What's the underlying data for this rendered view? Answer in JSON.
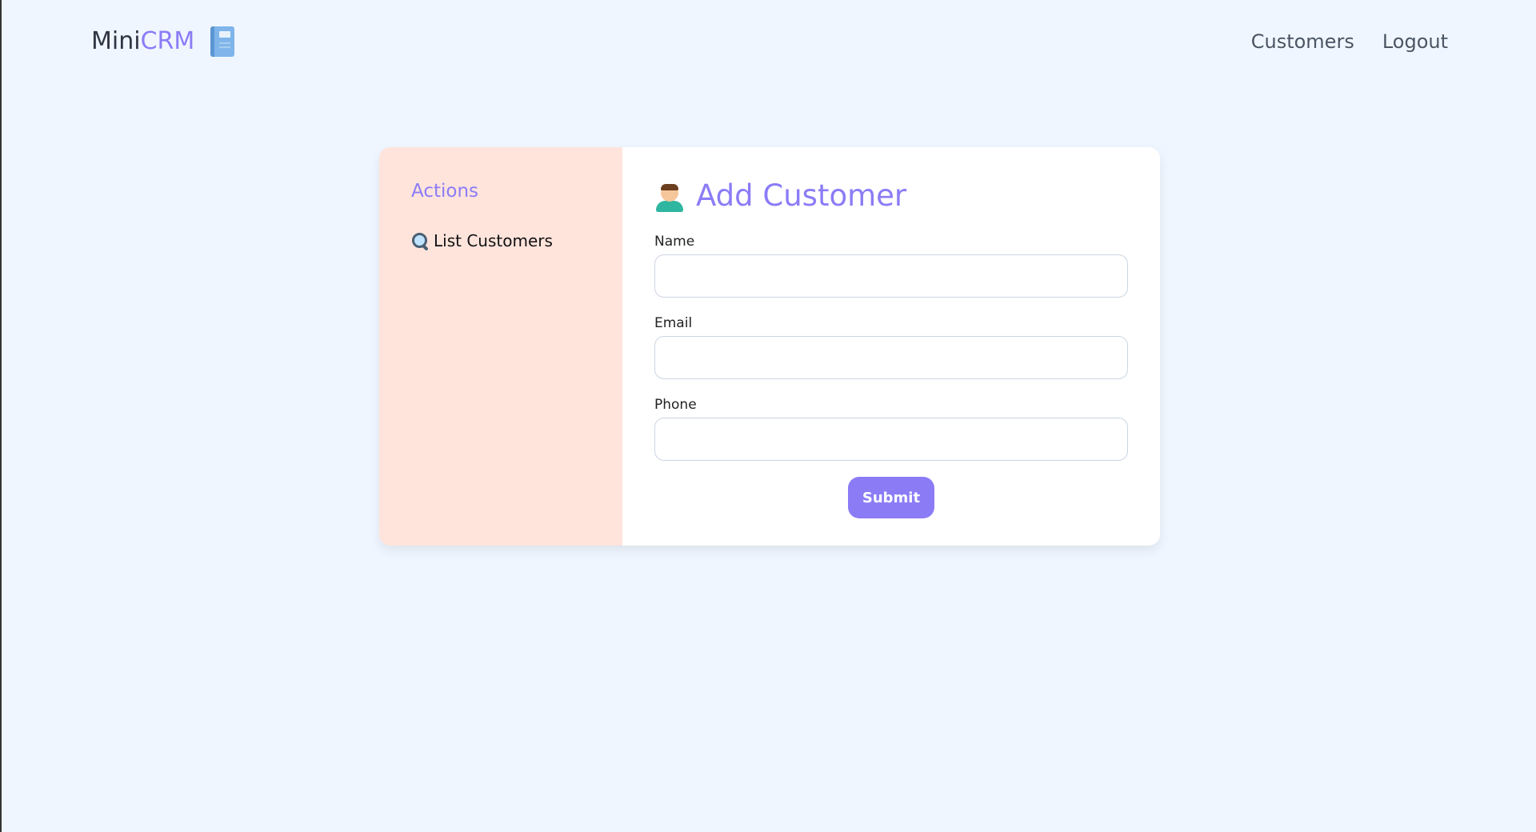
{
  "header": {
    "brand_main": "Mini",
    "brand_accent": "CRM",
    "brand_icon": "notebook-icon",
    "nav": [
      {
        "label": "Customers"
      },
      {
        "label": "Logout"
      }
    ]
  },
  "sidebar": {
    "title": "Actions",
    "items": [
      {
        "icon": "magnifying-glass-icon",
        "label": "List Customers"
      }
    ]
  },
  "form": {
    "title": "Add Customer",
    "title_icon": "person-icon",
    "fields": [
      {
        "label": "Name",
        "value": "",
        "placeholder": ""
      },
      {
        "label": "Email",
        "value": "",
        "placeholder": ""
      },
      {
        "label": "Phone",
        "value": "",
        "placeholder": ""
      }
    ],
    "submit_label": "Submit"
  },
  "colors": {
    "accent": "#8b7cf6",
    "background": "#eff6ff",
    "sidebar_bg": "#ffe4dc",
    "text": "#2f3542"
  }
}
